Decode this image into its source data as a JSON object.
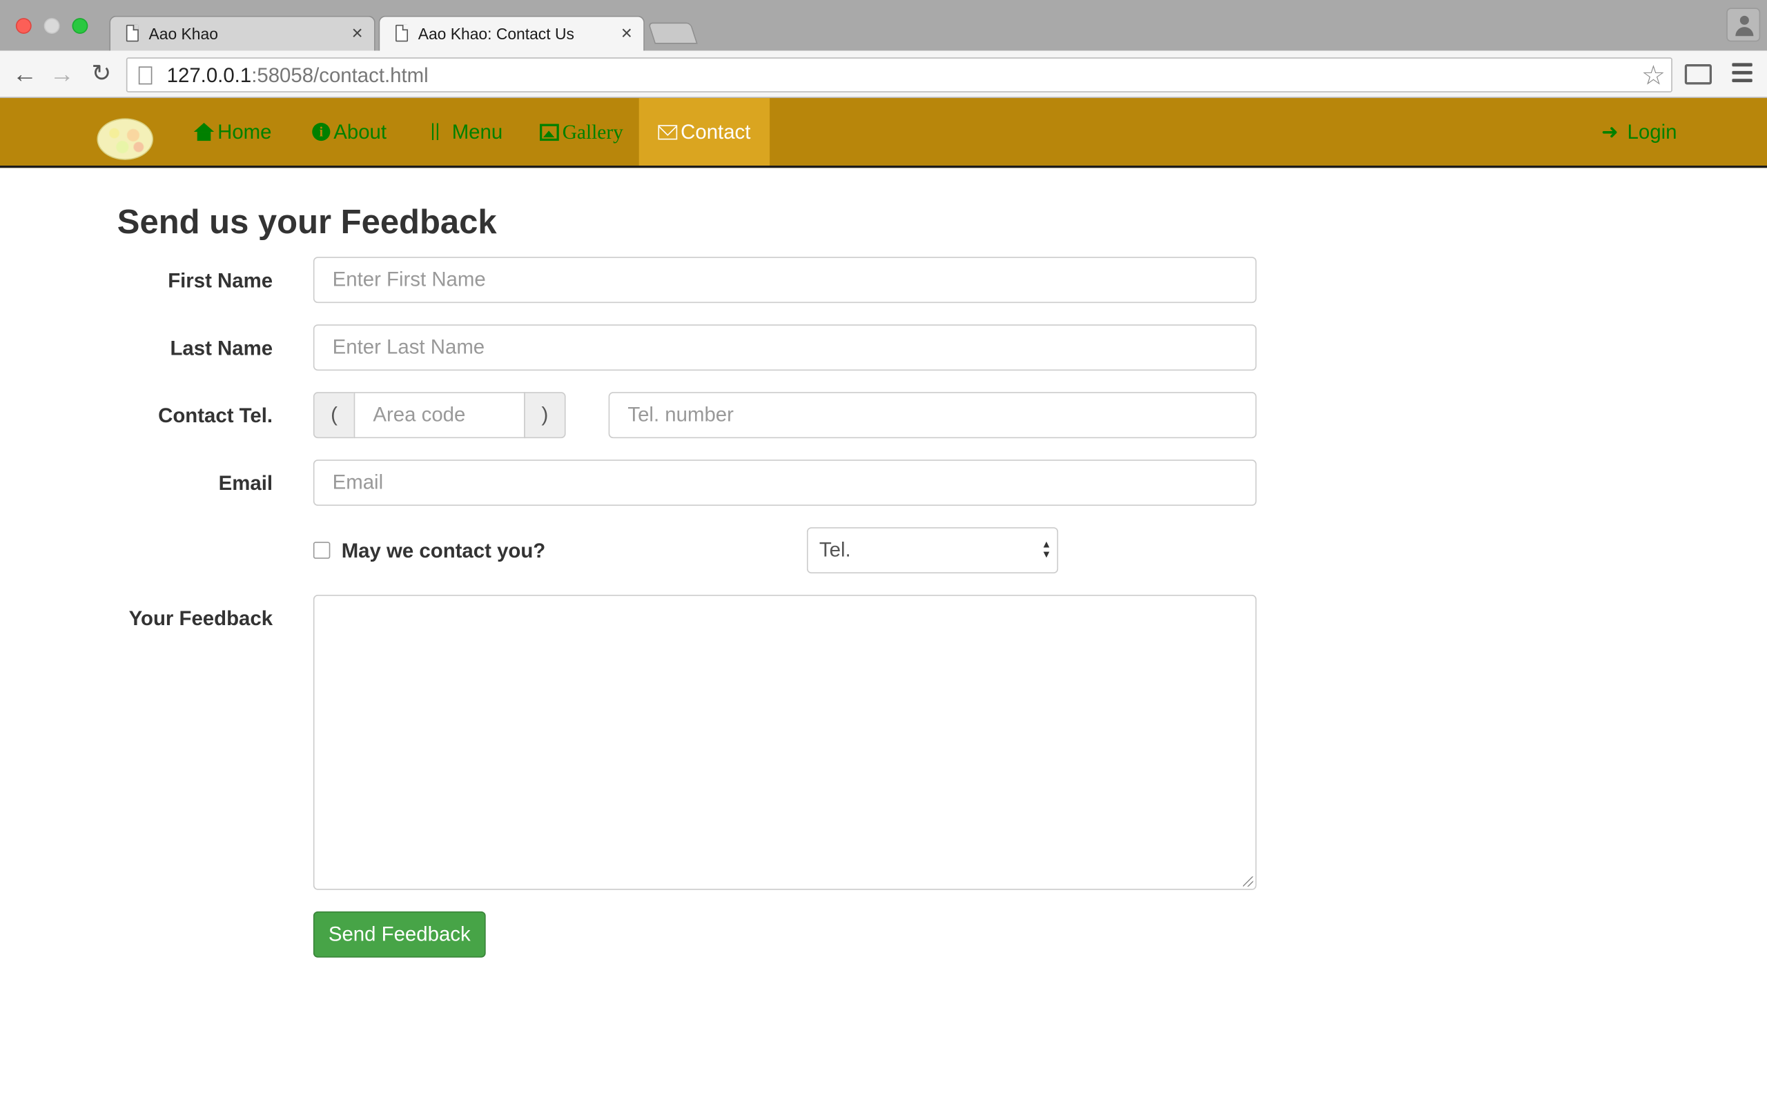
{
  "browser": {
    "tabs": [
      {
        "title": "Aao Khao",
        "close": "×"
      },
      {
        "title": "Aao Khao: Contact Us",
        "close": "×"
      }
    ],
    "url_host": "127.0.0.1",
    "url_rest": ":58058/contact.html"
  },
  "nav": {
    "home": "Home",
    "about": "About",
    "menu": "Menu",
    "gallery": "Gallery",
    "contact": "Contact",
    "login": "Login",
    "brand_color": "#b8860b",
    "active_color": "#daa520",
    "link_color": "#008000"
  },
  "form": {
    "title": "Send us your Feedback",
    "first_name_label": "First Name",
    "first_name_placeholder": "Enter First Name",
    "last_name_label": "Last Name",
    "last_name_placeholder": "Enter Last Name",
    "tel_label": "Contact Tel.",
    "paren_open": "(",
    "area_code_placeholder": "Area code",
    "paren_close": ")",
    "tel_number_placeholder": "Tel. number",
    "email_label": "Email",
    "email_placeholder": "Email",
    "contact_checkbox_label": "May we contact you?",
    "contact_method_selected": "Tel.",
    "feedback_label": "Your Feedback",
    "submit_label": "Send Feedback",
    "submit_color": "#47a447"
  }
}
